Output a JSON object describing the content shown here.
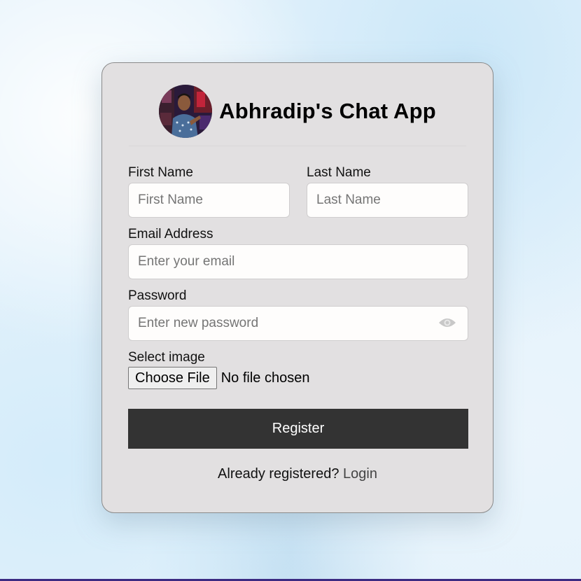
{
  "app": {
    "title": "Abhradip's Chat App"
  },
  "form": {
    "first_name": {
      "label": "First Name",
      "placeholder": "First Name",
      "value": ""
    },
    "last_name": {
      "label": "Last Name",
      "placeholder": "Last Name",
      "value": ""
    },
    "email": {
      "label": "Email Address",
      "placeholder": "Enter your email",
      "value": ""
    },
    "password": {
      "label": "Password",
      "placeholder": "Enter new password",
      "value": "",
      "toggle_icon": "eye-icon"
    },
    "image": {
      "label": "Select image",
      "button_label": "Choose File",
      "status": "No file chosen"
    },
    "submit_label": "Register"
  },
  "footer": {
    "prompt": "Already registered?",
    "link_label": "Login"
  },
  "colors": {
    "card_bg": "#e2e0e1",
    "button_bg": "#333333",
    "button_text": "#ffffff",
    "page_bg": "#e4f2fb"
  }
}
